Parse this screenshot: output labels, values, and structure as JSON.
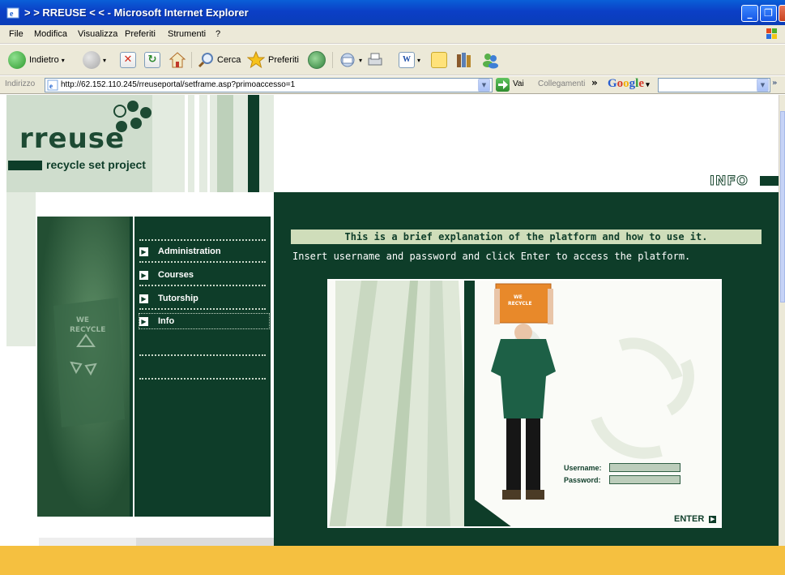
{
  "window": {
    "title": "> > RREUSE < < - Microsoft Internet Explorer",
    "controls": {
      "minimize": "_",
      "maximize": "❐",
      "close": "✕"
    }
  },
  "menu": [
    "File",
    "Modifica",
    "Visualizza",
    "Preferiti",
    "Strumenti",
    "?"
  ],
  "toolbar": {
    "back_label": "Indietro",
    "search_label": "Cerca",
    "favorites_label": "Preferiti"
  },
  "address": {
    "label": "Indirizzo",
    "url": "http://62.152.110.245/rreuseportal/setframe.asp?primoaccesso=1",
    "go_label": "Vai",
    "links_label": "Collegamenti",
    "chevron": "»",
    "google_label": "Google"
  },
  "site": {
    "logo": "rreuse",
    "subtitle": "recycle set project",
    "section_title": "INFO",
    "nav": [
      {
        "label": "Administration"
      },
      {
        "label": "Courses"
      },
      {
        "label": "Tutorship"
      },
      {
        "label": "Info"
      }
    ],
    "banner": "This is a brief explanation of the platform and how to use it.",
    "description": "Insert username and password and click Enter to access the platform.",
    "login": {
      "username_label": "Username:",
      "password_label": "Password:",
      "enter_label": "ENTER"
    }
  },
  "colors": {
    "dark_green": "#0e3d29",
    "light_green": "#cfddcd",
    "banner_green": "#cfddba",
    "footer_yellow": "#f5c040",
    "xp_blue": "#0b3fc6"
  }
}
